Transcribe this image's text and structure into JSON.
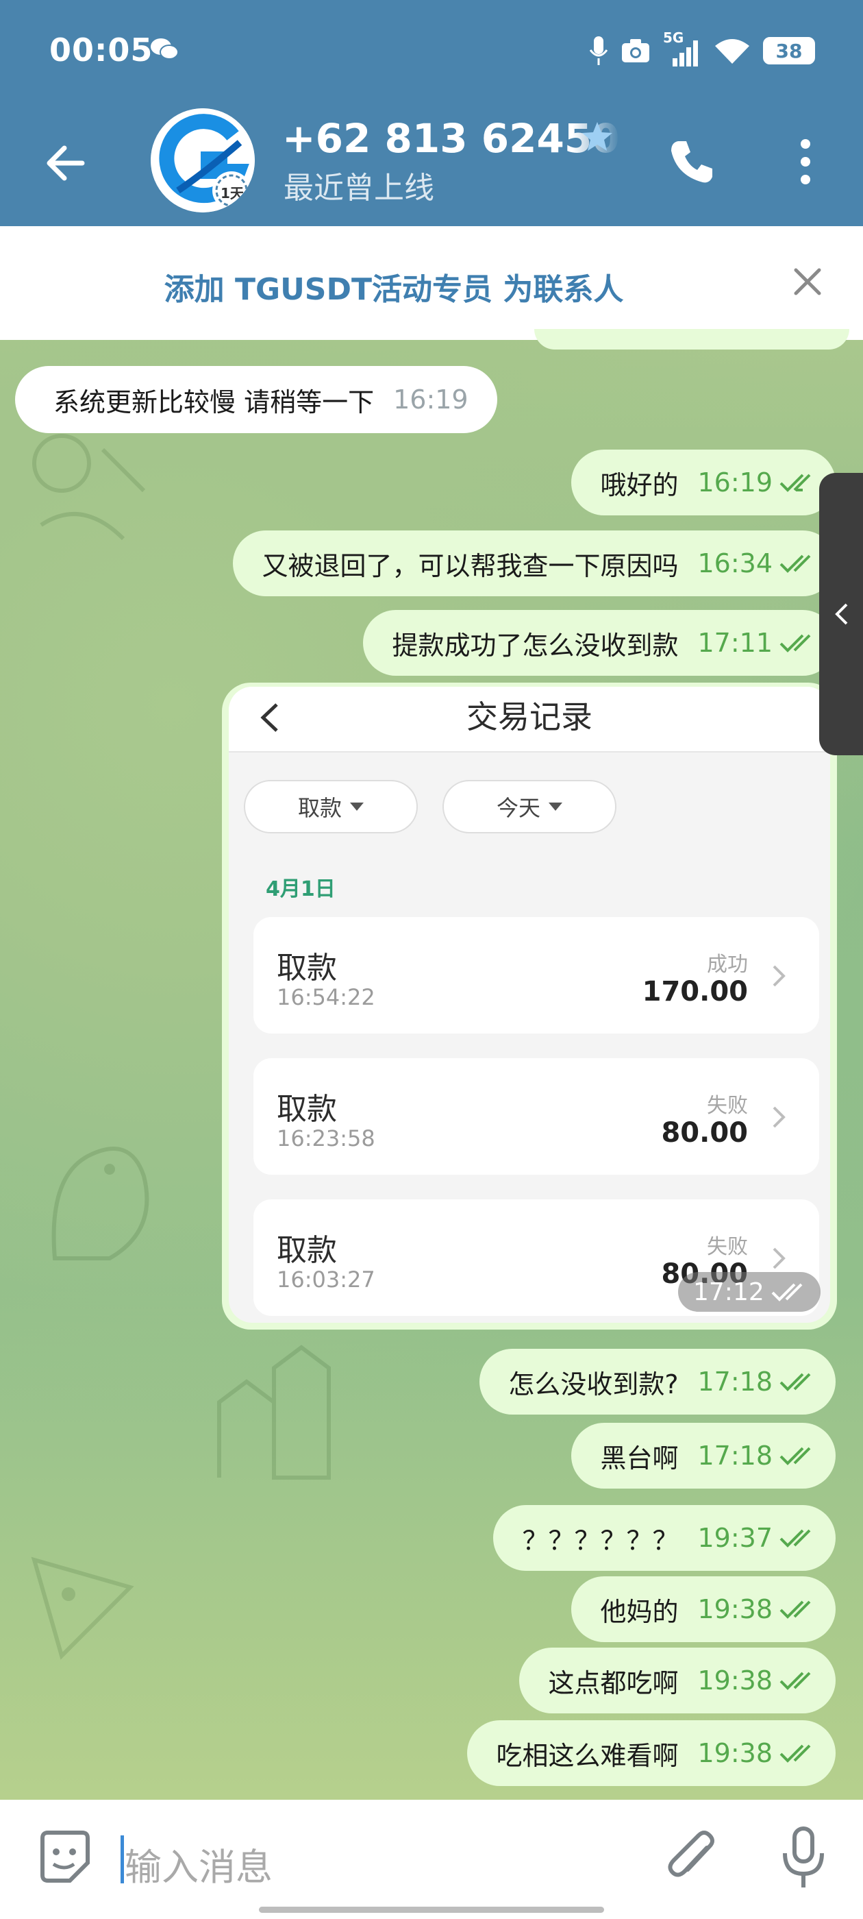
{
  "status_bar": {
    "time": "00:05",
    "network": "5G",
    "battery": "38"
  },
  "header": {
    "contact_name": "+62 813 62450",
    "last_seen": "最近曾上线",
    "avatar_badge": "1天"
  },
  "add_contact_banner": {
    "text": "添加 TGUSDT活动专员 为联系人"
  },
  "messages": [
    {
      "direction": "in",
      "text": "系统更新比较慢   请稍等一下",
      "time": "16:19"
    },
    {
      "direction": "out",
      "text": "哦好的",
      "time": "16:19",
      "read": true
    },
    {
      "direction": "out",
      "text": "又被退回了，可以帮我查一下原因吗",
      "time": "16:34",
      "read": true
    },
    {
      "direction": "out",
      "text": "提款成功了怎么没收到款",
      "time": "17:11",
      "read": true
    },
    {
      "direction": "out",
      "text": "怎么没收到款?",
      "time": "17:18",
      "read": true
    },
    {
      "direction": "out",
      "text": "黑台啊",
      "time": "17:18",
      "read": true
    },
    {
      "direction": "out",
      "text": "？？？？？？",
      "time": "19:37",
      "read": true
    },
    {
      "direction": "out",
      "text": "他妈的",
      "time": "19:38",
      "read": true
    },
    {
      "direction": "out",
      "text": "这点都吃啊",
      "time": "19:38",
      "read": true
    },
    {
      "direction": "out",
      "text": "吃相这么难看啊",
      "time": "19:38",
      "read": true
    }
  ],
  "image_message": {
    "time": "17:12",
    "screenshot": {
      "title": "交易记录",
      "filters": [
        "取款",
        "今天"
      ],
      "date": "4月1日",
      "records": [
        {
          "type": "取款",
          "time": "16:54:22",
          "status": "成功",
          "amount": "170.00"
        },
        {
          "type": "取款",
          "time": "16:23:58",
          "status": "失败",
          "amount": "80.00"
        },
        {
          "type": "取款",
          "time": "16:03:27",
          "status": "失败",
          "amount": "80.00"
        }
      ]
    }
  },
  "input": {
    "placeholder": "输入消息"
  },
  "colors": {
    "header": "#4a84ad",
    "outgoing_bubble": "#e7fbd8",
    "incoming_bubble": "#ffffff",
    "read_check": "#55a94d",
    "banner_text": "#3f7fb0"
  }
}
